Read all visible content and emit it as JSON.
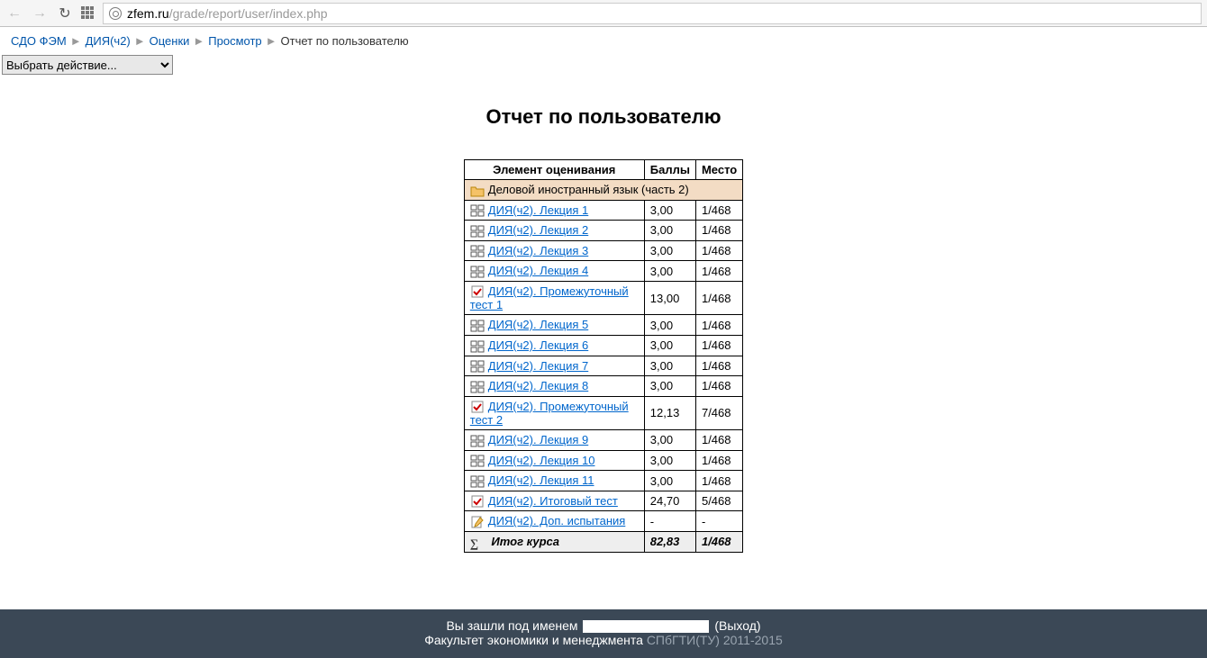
{
  "url": {
    "domain": "zfem.ru",
    "path": "/grade/report/user/index.php"
  },
  "breadcrumb": [
    "СДО ФЭМ",
    "ДИЯ(ч2)",
    "Оценки",
    "Просмотр",
    "Отчет по пользователю"
  ],
  "action_select": {
    "selected": "Выбрать действие..."
  },
  "page_title": "Отчет по пользователю",
  "table": {
    "headers": [
      "Элемент оценивания",
      "Баллы",
      "Место"
    ],
    "course": "Деловой иностранный язык (часть 2)",
    "rows": [
      {
        "icon": "lesson",
        "name": "ДИЯ(ч2). Лекция 1",
        "score": "3,00",
        "rank": "1/468"
      },
      {
        "icon": "lesson",
        "name": "ДИЯ(ч2). Лекция 2",
        "score": "3,00",
        "rank": "1/468"
      },
      {
        "icon": "lesson",
        "name": "ДИЯ(ч2). Лекция 3",
        "score": "3,00",
        "rank": "1/468"
      },
      {
        "icon": "lesson",
        "name": "ДИЯ(ч2). Лекция 4",
        "score": "3,00",
        "rank": "1/468"
      },
      {
        "icon": "quiz",
        "name": "ДИЯ(ч2). Промежуточный тест 1",
        "score": "13,00",
        "rank": "1/468"
      },
      {
        "icon": "lesson",
        "name": "ДИЯ(ч2). Лекция 5",
        "score": "3,00",
        "rank": "1/468"
      },
      {
        "icon": "lesson",
        "name": "ДИЯ(ч2). Лекция 6",
        "score": "3,00",
        "rank": "1/468"
      },
      {
        "icon": "lesson",
        "name": "ДИЯ(ч2). Лекция 7",
        "score": "3,00",
        "rank": "1/468"
      },
      {
        "icon": "lesson",
        "name": "ДИЯ(ч2). Лекция 8",
        "score": "3,00",
        "rank": "1/468"
      },
      {
        "icon": "quiz",
        "name": "ДИЯ(ч2). Промежуточный тест 2",
        "score": "12,13",
        "rank": "7/468"
      },
      {
        "icon": "lesson",
        "name": "ДИЯ(ч2). Лекция 9",
        "score": "3,00",
        "rank": "1/468"
      },
      {
        "icon": "lesson",
        "name": "ДИЯ(ч2). Лекция 10",
        "score": "3,00",
        "rank": "1/468"
      },
      {
        "icon": "lesson",
        "name": "ДИЯ(ч2). Лекция 11",
        "score": "3,00",
        "rank": "1/468"
      },
      {
        "icon": "quiz",
        "name": "ДИЯ(ч2). Итоговый тест",
        "score": "24,70",
        "rank": "5/468"
      },
      {
        "icon": "assign",
        "name": "ДИЯ(ч2). Доп. испытания",
        "score": "-",
        "rank": "-"
      }
    ],
    "total": {
      "label": "Итог курса",
      "score": "82,83",
      "rank": "1/468"
    }
  },
  "footer": {
    "logged_in_prefix": "Вы зашли под именем",
    "logout_label": "Выход",
    "org_text": "Факультет экономики и менеджмента",
    "org_link": "СПбГТИ(ТУ) 2011-2015"
  }
}
